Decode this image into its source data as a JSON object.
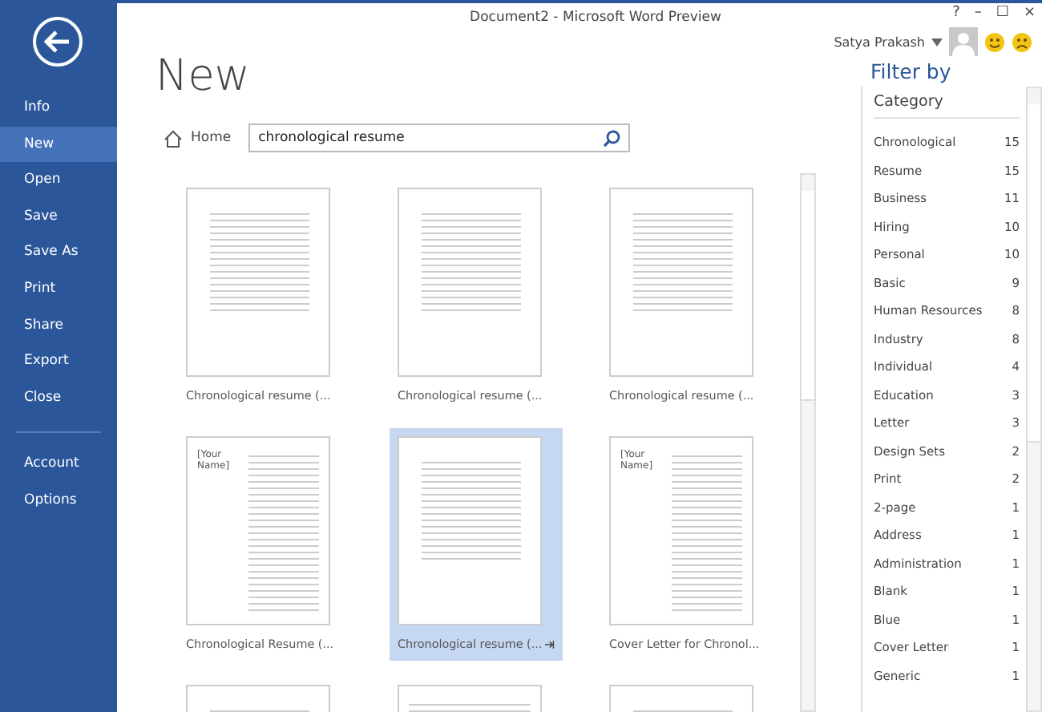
{
  "window": {
    "title": "Document2 - Microsoft Word Preview",
    "controls": [
      "?",
      "–",
      "☐",
      "×"
    ]
  },
  "user": {
    "name": "Satya Prakash"
  },
  "sidebar": {
    "items": [
      {
        "label": "Info",
        "selected": false
      },
      {
        "label": "New",
        "selected": true
      },
      {
        "label": "Open",
        "selected": false
      },
      {
        "label": "Save",
        "selected": false
      },
      {
        "label": "Save As",
        "selected": false
      },
      {
        "label": "Print",
        "selected": false
      },
      {
        "label": "Share",
        "selected": false
      },
      {
        "label": "Export",
        "selected": false
      },
      {
        "label": "Close",
        "selected": false
      }
    ],
    "bottom_items": [
      {
        "label": "Account",
        "selected": false
      },
      {
        "label": "Options",
        "selected": false
      }
    ]
  },
  "page_title": "New",
  "breadcrumb": "Home",
  "search": {
    "value": "chronological resume"
  },
  "templates": [
    {
      "label": "Chronological resume (...",
      "selected": false,
      "kind": "resume"
    },
    {
      "label": "Chronological resume (...",
      "selected": false,
      "kind": "resume"
    },
    {
      "label": "Chronological resume (...",
      "selected": false,
      "kind": "resume"
    },
    {
      "label": "Chronological Resume (...",
      "selected": false,
      "kind": "sidebar",
      "thumb_title": "[Your Name]"
    },
    {
      "label": "Chronological resume (...",
      "selected": true,
      "kind": "resume"
    },
    {
      "label": "Cover Letter for Chronol...",
      "selected": false,
      "kind": "sidebar",
      "thumb_title": "[Your Name]"
    },
    {
      "selected": false,
      "kind": "resume"
    },
    {
      "selected": false,
      "kind": "banner"
    },
    {
      "selected": false,
      "kind": "resume"
    }
  ],
  "filter": {
    "title": "Filter by",
    "heading": "Category",
    "items": [
      {
        "name": "Chronological",
        "count": "15"
      },
      {
        "name": "Resume",
        "count": "15"
      },
      {
        "name": "Business",
        "count": "11"
      },
      {
        "name": "Hiring",
        "count": "10"
      },
      {
        "name": "Personal",
        "count": "10"
      },
      {
        "name": "Basic",
        "count": "9"
      },
      {
        "name": "Human Resources",
        "count": "8"
      },
      {
        "name": "Industry",
        "count": "8"
      },
      {
        "name": "Individual",
        "count": "4"
      },
      {
        "name": "Education",
        "count": "3"
      },
      {
        "name": "Letter",
        "count": "3"
      },
      {
        "name": "Design Sets",
        "count": "2"
      },
      {
        "name": "Print",
        "count": "2"
      },
      {
        "name": "2-page",
        "count": "1"
      },
      {
        "name": "Address",
        "count": "1"
      },
      {
        "name": "Administration",
        "count": "1"
      },
      {
        "name": "Blank",
        "count": "1"
      },
      {
        "name": "Blue",
        "count": "1"
      },
      {
        "name": "Cover Letter",
        "count": "1"
      },
      {
        "name": "Generic",
        "count": "1"
      }
    ]
  }
}
